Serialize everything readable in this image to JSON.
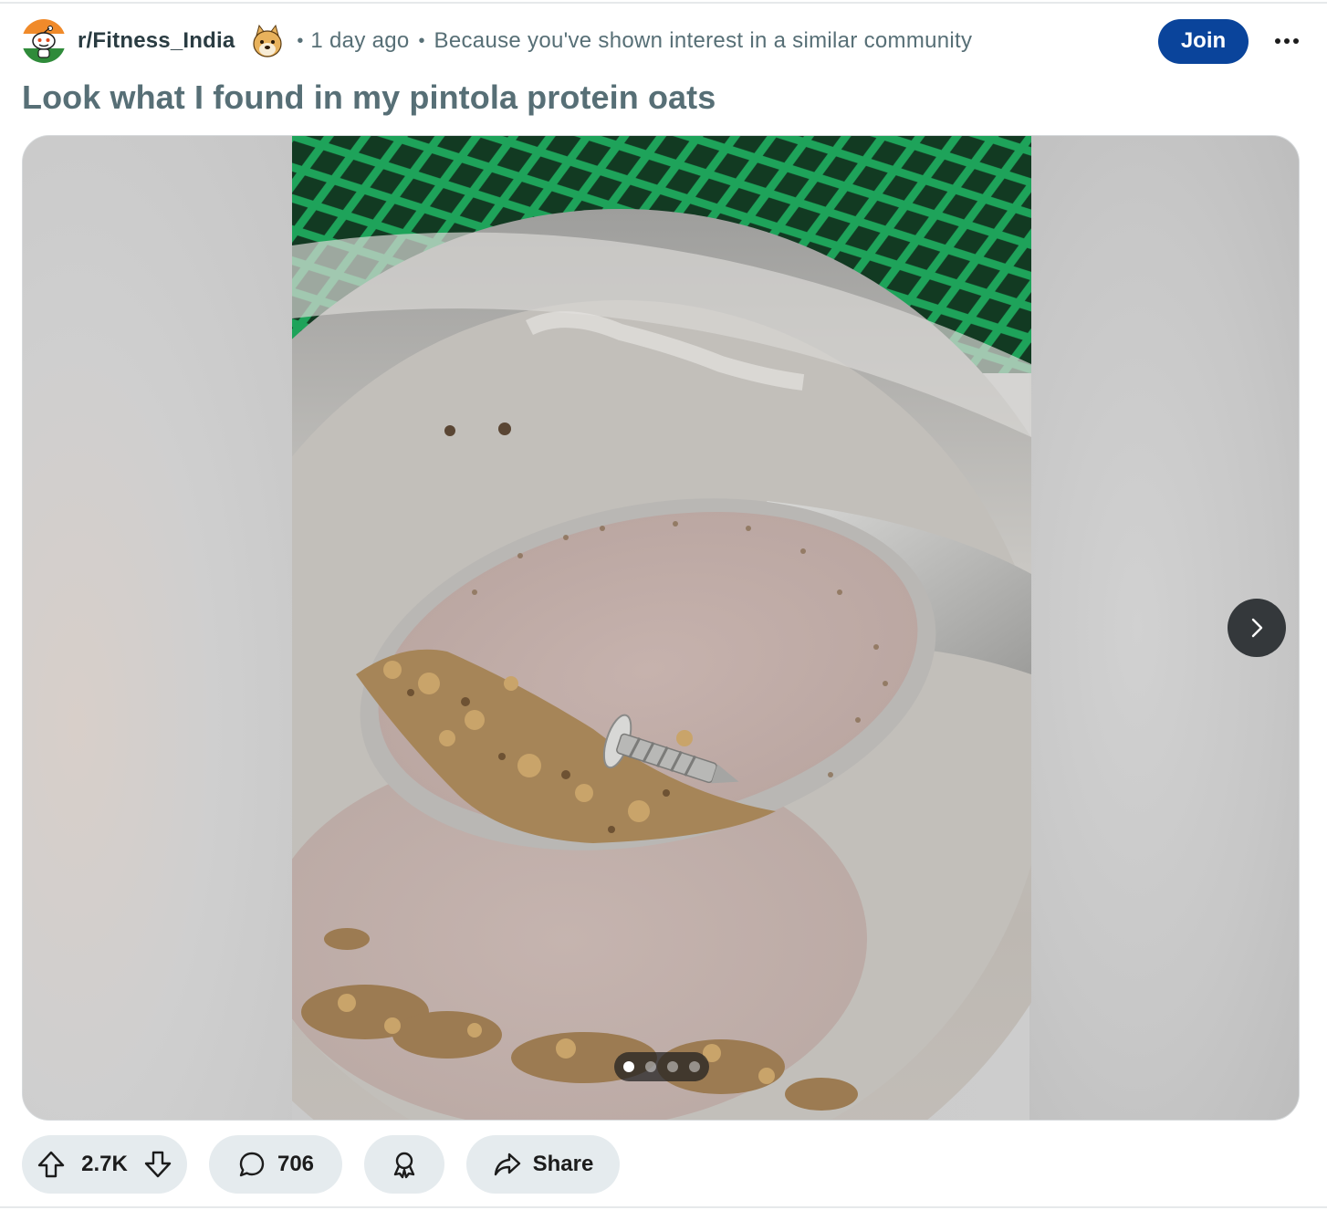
{
  "post": {
    "subreddit": "r/Fitness_India",
    "time": "1 day ago",
    "recommendation_reason": "Because you've shown interest in a similar community",
    "title": "Look what I found in my pintola protein oats"
  },
  "header": {
    "join_label": "Join",
    "more_icon": "more-horizontal-icon"
  },
  "gallery": {
    "page_count": 4,
    "current_page": 1,
    "next_icon": "chevron-right-icon"
  },
  "actions": {
    "score": "2.7K",
    "comments": "706",
    "share_label": "Share",
    "upvote_icon": "upvote-icon",
    "downvote_icon": "downvote-icon",
    "comment_icon": "comment-icon",
    "award_icon": "award-icon",
    "share_icon": "share-icon"
  },
  "colors": {
    "join_button": "#0a449b",
    "action_pill": "#e5ebee",
    "meta_text": "#576f76",
    "subreddit_text": "#2a3c42"
  }
}
